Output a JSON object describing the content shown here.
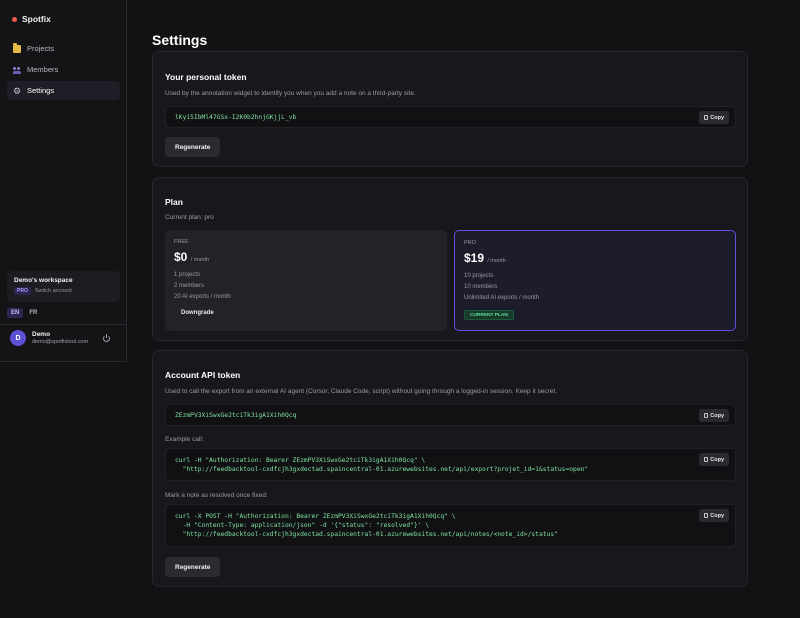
{
  "app": {
    "name": "Spotfix"
  },
  "sidebar": {
    "items": [
      {
        "label": "Projects",
        "icon": "folder-icon"
      },
      {
        "label": "Members",
        "icon": "members-icon"
      },
      {
        "label": "Settings",
        "icon": "gear-icon"
      }
    ],
    "active_index": 2,
    "workspace": {
      "name": "Demo's workspace",
      "badge": "PRO",
      "switch_label": "Switch account"
    },
    "languages": [
      {
        "code": "EN",
        "active": true
      },
      {
        "code": "FR",
        "active": false
      }
    ],
    "user": {
      "initial": "D",
      "name": "Demo",
      "email": "demo@spotfixtool.com"
    }
  },
  "page": {
    "title": "Settings"
  },
  "personal_token": {
    "title": "Your personal token",
    "description": "Used by the annotation widget to identify you when you add a note on a third-party site.",
    "token": "lKyi5IbMl47GSx-I2K0b2hnjGKjjL_vb",
    "copy_label": "Copy",
    "regenerate_label": "Regenerate"
  },
  "plan": {
    "title": "Plan",
    "current": "Current plan: pro",
    "tiers": [
      {
        "label": "FREE",
        "price": "$0",
        "period": "/ month",
        "features": [
          "1 projects",
          "2 members",
          "20 AI exports / month"
        ],
        "action": "Downgrade"
      },
      {
        "label": "PRO",
        "price": "$19",
        "period": "/ month",
        "features": [
          "10 projects",
          "10 members",
          "Unlimited AI exports / month"
        ],
        "action": "CURRENT PLAN"
      }
    ]
  },
  "api_token": {
    "title": "Account API token",
    "description": "Used to call the export from an external AI agent (Cursor, Claude Code, script) without going through a logged-in session. Keep it secret.",
    "token": "ZEzmPV3XiSwxGe2tciTk3igA1Xih0Qcq",
    "copy_label": "Copy",
    "example_label": "Example call:",
    "example_code": "curl -H \"Authorization: Bearer ZEzmPV3XiSwxGe2tciTk3igA1Xih0Qcq\" \\\n  \"http://feedbacktool-cxdfcjh3gxdectad.spaincentral-01.azurewebsites.net/api/export?projet_id=1&status=open\"",
    "resolve_label": "Mark a note as resolved once fixed:",
    "resolve_code": "curl -X POST -H \"Authorization: Bearer ZEzmPV3XiSwxGe2tciTk3igA1Xih0Qcq\" \\\n  -H \"Content-Type: application/json\" -d '{\"status\": \"resolved\"}' \\\n  \"http://feedbacktool-cxdfcjh3gxdectad.spaincentral-01.azurewebsites.net/api/notes/<note_id>/status\"",
    "regenerate_label": "Regenerate"
  },
  "colors": {
    "accent": "#5f52e0",
    "code": "#7fe3a3",
    "brand_dot": "#ef5b4b"
  }
}
